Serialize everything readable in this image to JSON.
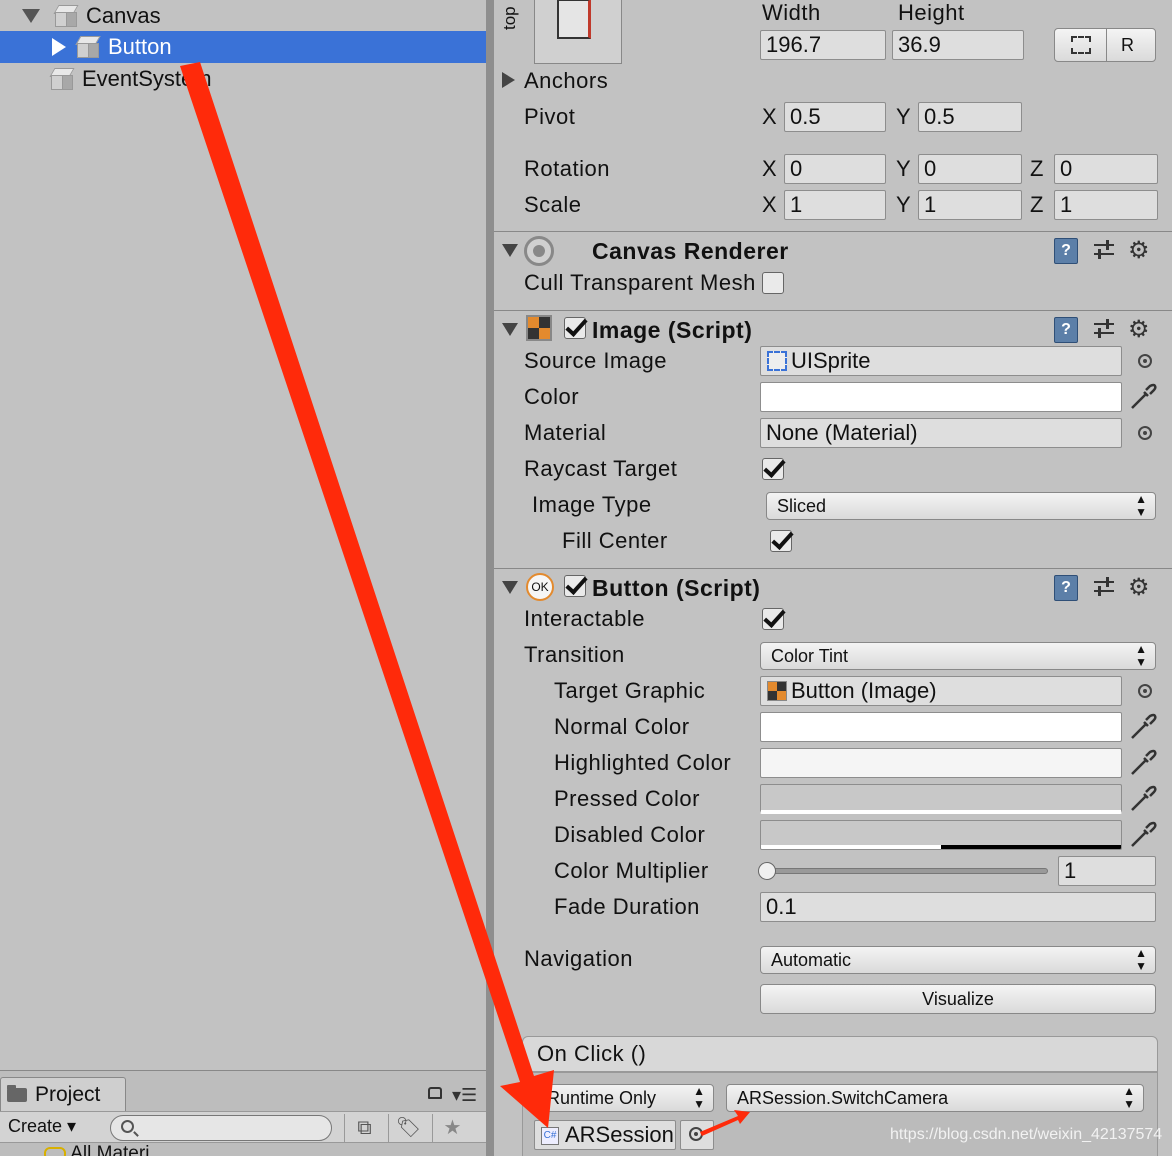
{
  "hierarchy": {
    "items": [
      {
        "label": "Canvas"
      },
      {
        "label": "Button"
      },
      {
        "label": "EventSystem"
      }
    ]
  },
  "project": {
    "tab_label": "Project",
    "create_label": "Create",
    "folder_label": "All Materi"
  },
  "rect_transform": {
    "anchor_preset_label": "top",
    "width_label": "Width",
    "height_label": "Height",
    "width_value": "196.7",
    "height_value": "36.9",
    "raw_edit_label": "R",
    "anchors_label": "Anchors",
    "pivot_label": "Pivot",
    "pivot_x": "0.5",
    "pivot_y": "0.5",
    "rotation_label": "Rotation",
    "rotation_x": "0",
    "rotation_y": "0",
    "rotation_z": "0",
    "scale_label": "Scale",
    "scale_x": "1",
    "scale_y": "1",
    "scale_z": "1",
    "axis_x": "X",
    "axis_y": "Y",
    "axis_z": "Z"
  },
  "canvas_renderer": {
    "title": "Canvas Renderer",
    "cull_label": "Cull Transparent Mesh"
  },
  "image_script": {
    "title": "Image (Script)",
    "source_image_label": "Source Image",
    "source_image_value": "UISprite",
    "color_label": "Color",
    "material_label": "Material",
    "material_value": "None (Material)",
    "raycast_label": "Raycast Target",
    "image_type_label": "Image Type",
    "image_type_value": "Sliced",
    "fill_center_label": "Fill Center"
  },
  "button_script": {
    "title": "Button (Script)",
    "ok_icon_text": "OK",
    "interactable_label": "Interactable",
    "transition_label": "Transition",
    "transition_value": "Color Tint",
    "target_graphic_label": "Target Graphic",
    "target_graphic_value": "Button (Image)",
    "normal_color_label": "Normal Color",
    "highlighted_color_label": "Highlighted Color",
    "pressed_color_label": "Pressed Color",
    "disabled_color_label": "Disabled Color",
    "color_multiplier_label": "Color Multiplier",
    "color_multiplier_value": "1",
    "color_multiplier_slider": 0,
    "fade_duration_label": "Fade Duration",
    "fade_duration_value": "0.1",
    "navigation_label": "Navigation",
    "navigation_value": "Automatic",
    "visualize_label": "Visualize",
    "help_icon_text": "?"
  },
  "on_click": {
    "title": "On Click ()",
    "runtime_value": "Runtime Only",
    "function_value": "ARSession.SwitchCamera",
    "object_value": "ARSession",
    "script_icon_text": "C#"
  },
  "watermark": "https://blog.csdn.net/weixin_42137574",
  "colors": {
    "selection": "#3a72d7",
    "annotation_arrow": "#ff2a0a",
    "panel_bg": "#c2c2c2"
  }
}
